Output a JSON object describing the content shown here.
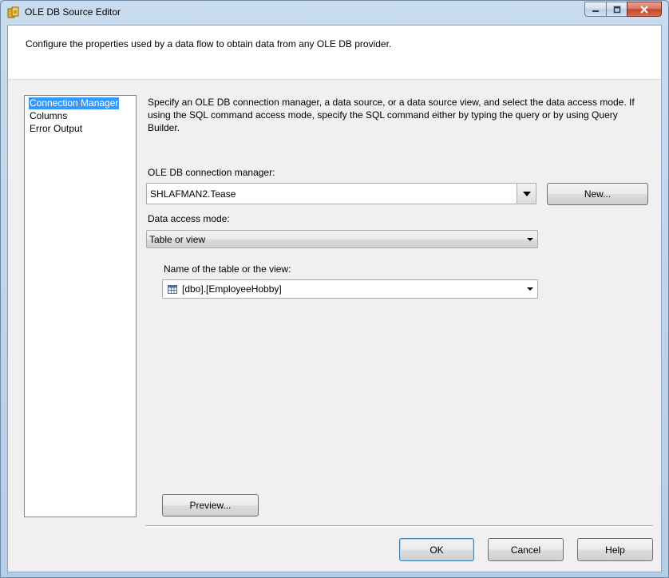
{
  "window": {
    "title": "OLE DB Source Editor"
  },
  "header": {
    "text": "Configure the properties used by a data flow to obtain data from any OLE DB provider."
  },
  "nav": {
    "items": [
      {
        "label": "Connection Manager",
        "selected": true
      },
      {
        "label": "Columns",
        "selected": false
      },
      {
        "label": "Error Output",
        "selected": false
      }
    ]
  },
  "main": {
    "description": "Specify an OLE DB connection manager, a data source, or a data source view, and select the data access mode. If using the SQL command access mode, specify the SQL command either by typing the query or by using Query Builder.",
    "connection_label": "OLE DB connection manager:",
    "connection_value": "SHLAFMAN2.Tease",
    "new_button": "New...",
    "access_mode_label": "Data access mode:",
    "access_mode_value": "Table or view",
    "table_label": "Name of the table or the view:",
    "table_value": "[dbo].[EmployeeHobby]",
    "preview_button": "Preview..."
  },
  "footer": {
    "ok": "OK",
    "cancel": "Cancel",
    "help": "Help"
  },
  "colors": {
    "selection": "#3399ff",
    "close_button": "#c5412a"
  }
}
